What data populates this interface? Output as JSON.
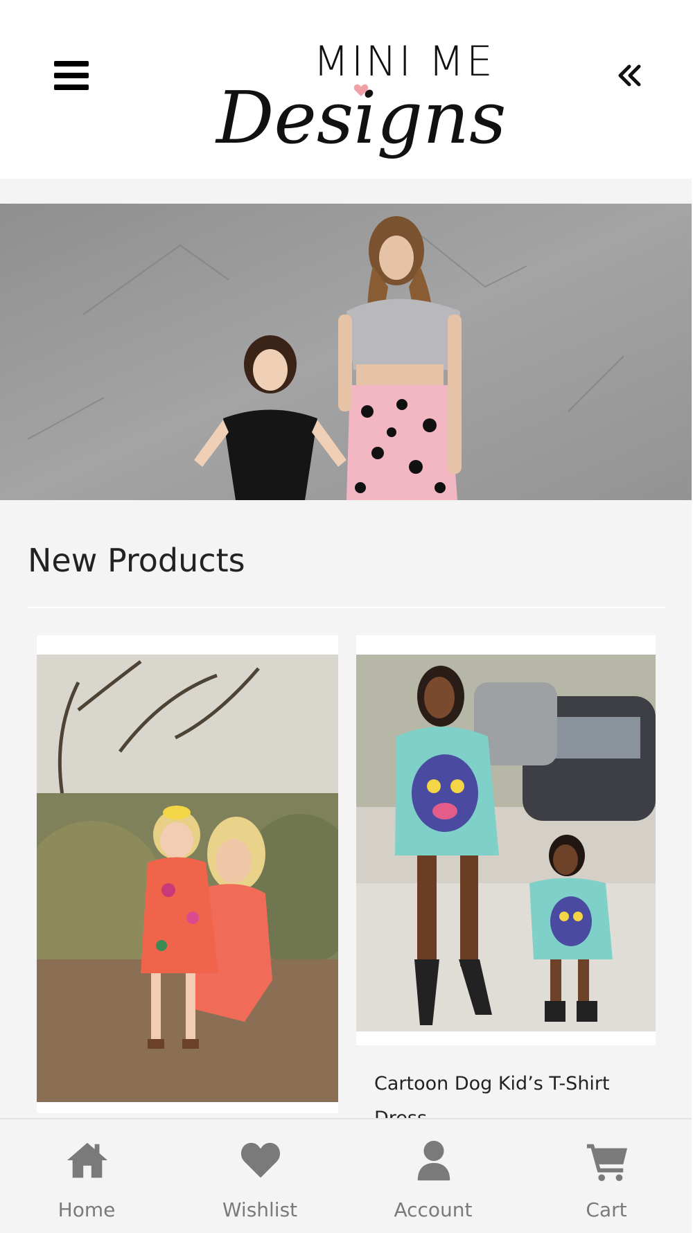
{
  "header": {
    "logo_line1": "MINI ME",
    "logo_line2": "Designs",
    "menu_icon": "hamburger-menu-icon",
    "back_icon": "double-chevron-left-icon"
  },
  "hero": {
    "image": "mother and daughter in matching black, grey and leopard print outfits against a concrete wall"
  },
  "main": {
    "section_title": "New Products",
    "products": [
      {
        "name": "",
        "image": "mother and daughter in matching coral floral dresses outdoors"
      },
      {
        "name": "Cartoon Dog Kid’s T-Shirt Dress",
        "image": "mother and daughter in matching teal cartoon dog sweatshirt dresses"
      }
    ]
  },
  "bottom_nav": {
    "items": [
      {
        "label": "Home",
        "icon": "home-icon"
      },
      {
        "label": "Wishlist",
        "icon": "heart-icon"
      },
      {
        "label": "Account",
        "icon": "user-icon"
      },
      {
        "label": "Cart",
        "icon": "cart-icon"
      }
    ]
  },
  "colors": {
    "page_background": "#f4f4f4",
    "nav_icon": "#7a7a7a",
    "logo_heart": "#f2a0a8"
  }
}
